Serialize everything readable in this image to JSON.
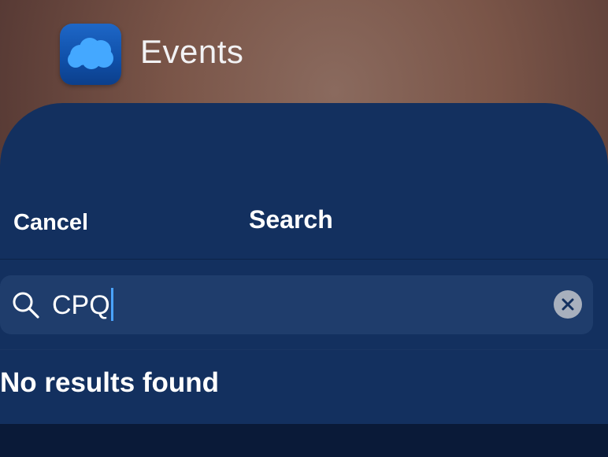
{
  "app": {
    "title": "Events",
    "icon": "salesforce-cloud-icon"
  },
  "sheet": {
    "cancel_label": "Cancel",
    "title": "Search"
  },
  "search": {
    "value": "CPQ",
    "search_icon": "search-icon",
    "clear_icon": "clear-icon"
  },
  "results": {
    "empty_message": "No results found"
  },
  "colors": {
    "sheet_bg": "#13305f",
    "field_bg": "#1f3d6c",
    "caret": "#4aa3ff",
    "app_icon": "#1565c0"
  }
}
